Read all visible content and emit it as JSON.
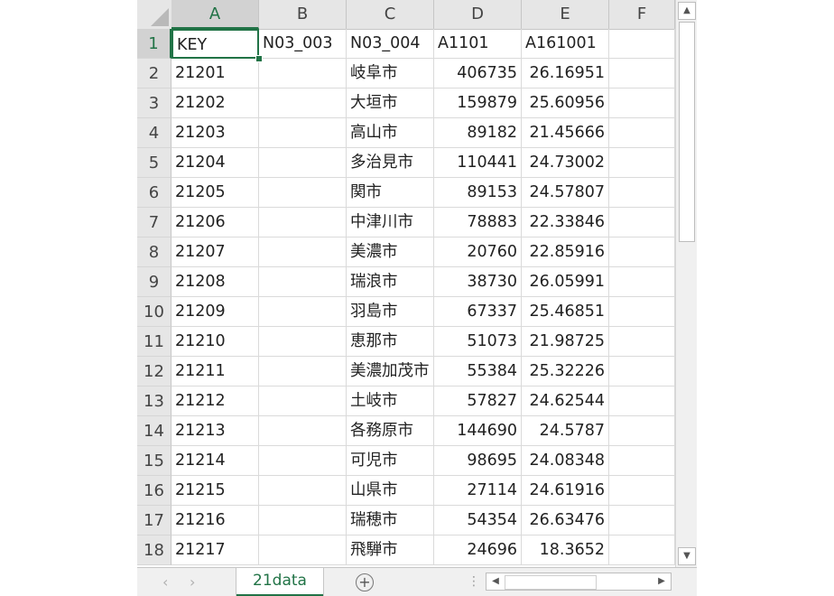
{
  "columns": [
    "A",
    "B",
    "C",
    "D",
    "E",
    "F"
  ],
  "selected_cell": "A1",
  "header_row": {
    "row": "1",
    "key": "KEY",
    "b": "N03_003",
    "c": "N03_004",
    "d": "A1101",
    "e": "A161001"
  },
  "rows": [
    {
      "row": "2",
      "key": "21201",
      "city": "岐阜市",
      "pop": "406735",
      "val": "26.16951"
    },
    {
      "row": "3",
      "key": "21202",
      "city": "大垣市",
      "pop": "159879",
      "val": "25.60956"
    },
    {
      "row": "4",
      "key": "21203",
      "city": "高山市",
      "pop": "89182",
      "val": "21.45666"
    },
    {
      "row": "5",
      "key": "21204",
      "city": "多治見市",
      "pop": "110441",
      "val": "24.73002"
    },
    {
      "row": "6",
      "key": "21205",
      "city": "関市",
      "pop": "89153",
      "val": "24.57807"
    },
    {
      "row": "7",
      "key": "21206",
      "city": "中津川市",
      "pop": "78883",
      "val": "22.33846"
    },
    {
      "row": "8",
      "key": "21207",
      "city": "美濃市",
      "pop": "20760",
      "val": "22.85916"
    },
    {
      "row": "9",
      "key": "21208",
      "city": "瑞浪市",
      "pop": "38730",
      "val": "26.05991"
    },
    {
      "row": "10",
      "key": "21209",
      "city": "羽島市",
      "pop": "67337",
      "val": "25.46851"
    },
    {
      "row": "11",
      "key": "21210",
      "city": "恵那市",
      "pop": "51073",
      "val": "21.98725"
    },
    {
      "row": "12",
      "key": "21211",
      "city": "美濃加茂市",
      "pop": "55384",
      "val": "25.32226"
    },
    {
      "row": "13",
      "key": "21212",
      "city": "土岐市",
      "pop": "57827",
      "val": "24.62544"
    },
    {
      "row": "14",
      "key": "21213",
      "city": "各務原市",
      "pop": "144690",
      "val": "24.5787"
    },
    {
      "row": "15",
      "key": "21214",
      "city": "可児市",
      "pop": "98695",
      "val": "24.08348"
    },
    {
      "row": "16",
      "key": "21215",
      "city": "山県市",
      "pop": "27114",
      "val": "24.61916"
    },
    {
      "row": "17",
      "key": "21216",
      "city": "瑞穂市",
      "pop": "54354",
      "val": "26.63476"
    },
    {
      "row": "18",
      "key": "21217",
      "city": "飛騨市",
      "pop": "24696",
      "val": "18.3652"
    }
  ],
  "sheet_tab": "21data",
  "icons": {
    "scroll_up": "▲",
    "scroll_down": "▼",
    "scroll_left": "◀",
    "scroll_right": "▶",
    "nav_prev": "‹",
    "nav_next": "›",
    "add_sheet": "+",
    "split_dots": "⋮"
  },
  "colors": {
    "accent": "#217346",
    "header_bg": "#e6e6e6",
    "grid": "#dadada"
  }
}
